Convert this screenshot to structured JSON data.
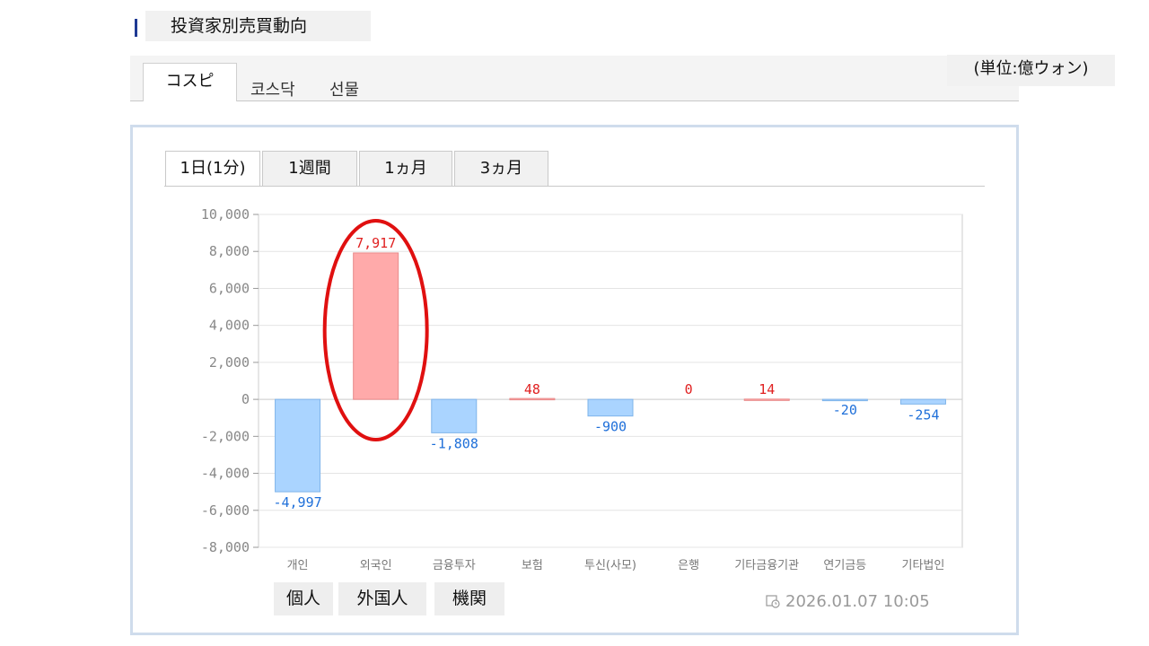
{
  "header": {
    "title": "投資家別売買動向"
  },
  "market_tabs": [
    {
      "label": "コスピ",
      "active": true
    },
    {
      "label": "코스닥",
      "active": false
    },
    {
      "label": "선물",
      "active": false
    }
  ],
  "unit_label": "(単位:億ウォン)",
  "period_tabs": [
    {
      "label": "1日(1分)",
      "active": true
    },
    {
      "label": "1週間",
      "active": false
    },
    {
      "label": "1ヵ月",
      "active": false
    },
    {
      "label": "3ヵ月",
      "active": false
    }
  ],
  "chart_data": {
    "type": "bar",
    "categories": [
      "개인",
      "외국인",
      "금융투자",
      "보험",
      "투신(사모)",
      "은행",
      "기타금융기관",
      "연기금등",
      "기타법인"
    ],
    "values": [
      -4997,
      7917,
      -1808,
      48,
      -900,
      0,
      14,
      -20,
      -254
    ],
    "value_labels": [
      "-4,997",
      "7,917",
      "-1,808",
      "48",
      "-900",
      "0",
      "14",
      "-20",
      "-254"
    ],
    "ylim": [
      -8000,
      10000
    ],
    "yticks": [
      10000,
      8000,
      6000,
      4000,
      2000,
      0,
      -2000,
      -4000,
      -6000,
      -8000
    ],
    "ytick_labels": [
      "10,000",
      "8,000",
      "6,000",
      "4,000",
      "2,000",
      "0",
      "-2,000",
      "-4,000",
      "-6,000",
      "-8,000"
    ],
    "grid": true,
    "colors": {
      "positive_fill": "#ffaaaa",
      "positive_label": "#e02020",
      "negative_fill": "#aad4ff",
      "negative_label": "#1e6fd9",
      "highlight_ellipse": "#e01010"
    },
    "highlight": "외국인"
  },
  "legend_boxes": [
    "個人",
    "外国人",
    "機関"
  ],
  "timestamp": "2026.01.07 10:05"
}
